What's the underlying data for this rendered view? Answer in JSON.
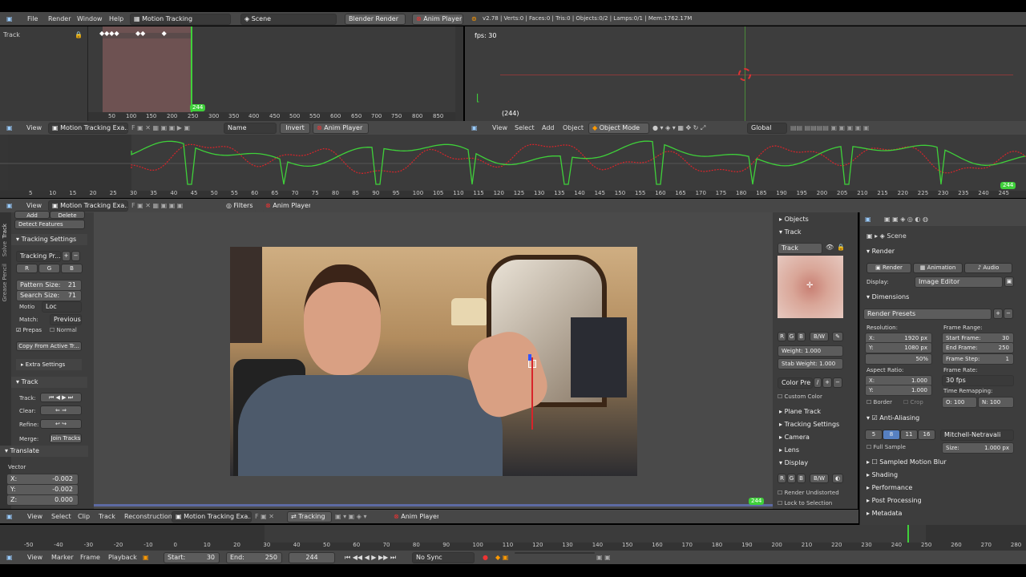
{
  "top": {
    "menus": [
      "File",
      "Render",
      "Window",
      "Help"
    ],
    "layout": "Motion Tracking",
    "scene": "Scene",
    "engine": "Blender Render",
    "anim_player": "Anim Player",
    "stats": "v2.78 | Verts:0 | Faces:0 | Tris:0 | Objects:0/2 | Lamps:0/1 | Mem:1762.17M"
  },
  "dopesheet": {
    "label": "Track",
    "frame_badge": "244",
    "ticks": [
      "50",
      "100",
      "150",
      "200",
      "250",
      "300",
      "350",
      "400",
      "450",
      "500",
      "550",
      "600",
      "650",
      "700",
      "750",
      "800",
      "850"
    ]
  },
  "view3d": {
    "fps": "fps: 30",
    "frame": "(244)",
    "menus": [
      "View",
      "Select",
      "Add",
      "Object"
    ],
    "mode": "Object Mode",
    "orientation": "Global"
  },
  "clip_header1": {
    "menu": "View",
    "clip": "Motion Tracking Exa...",
    "name_field": "Name",
    "invert": "Invert",
    "anim_player": "Anim Player"
  },
  "graph": {
    "ticks": [
      "5",
      "10",
      "15",
      "20",
      "25",
      "30",
      "35",
      "40",
      "45",
      "50",
      "55",
      "60",
      "65",
      "70",
      "75",
      "80",
      "85",
      "90",
      "95",
      "100",
      "105",
      "110",
      "115",
      "120",
      "125",
      "130",
      "135",
      "140",
      "145",
      "150",
      "155",
      "160",
      "165",
      "170",
      "175",
      "180",
      "185",
      "190",
      "195",
      "200",
      "205",
      "210",
      "215",
      "220",
      "225",
      "230",
      "235",
      "240",
      "245"
    ],
    "frame_badge": "244",
    "colors": {
      "red": "#d8242a",
      "green": "#3fd03a"
    }
  },
  "clip_header2": {
    "menu": "View",
    "clip": "Motion Tracking Exa...",
    "filters": "Filters",
    "anim_player": "Anim Player"
  },
  "left_panel": {
    "tabs": [
      "Track",
      "Solve",
      "Grease Pencil"
    ],
    "add": "Add",
    "delete": "Delete",
    "detect": "Detect Features",
    "tracking_settings": "Tracking Settings",
    "preset": "Tracking Pr...",
    "rgb": [
      "R",
      "G",
      "B"
    ],
    "pattern_size_label": "Pattern Size:",
    "pattern_size": "21",
    "search_size_label": "Search Size:",
    "search_size": "71",
    "motion_label": "Motio",
    "motion": "Loc",
    "match_label": "Match:",
    "match": "Previous",
    "prepass": "Prepas",
    "normalize": "Normal",
    "copy": "Copy From Active Tr...",
    "extra": "Extra Settings",
    "track_panel": "Track",
    "track_label": "Track:",
    "clear_label": "Clear:",
    "refine_label": "Refine:",
    "merge_label": "Merge:",
    "join": "Join Tracks",
    "translate": "Translate",
    "vector": "Vector",
    "x_label": "X:",
    "x": "-0.002",
    "y_label": "Y:",
    "y": "-0.002",
    "z_label": "Z:",
    "z": "0.000"
  },
  "clip_view": {
    "frame_badge": "244"
  },
  "track_panel": {
    "objects": "Objects",
    "track": "Track",
    "track_name": "Track",
    "rgb": [
      "R",
      "G",
      "B"
    ],
    "bw": "B/W",
    "weight_label": "Weight:",
    "weight": "1.000",
    "stab_label": "Stab Weight:",
    "stab": "1.000",
    "color_preset": "Color Pre",
    "custom_color": "Custom Color",
    "sections": [
      "Plane Track",
      "Tracking Settings",
      "Camera",
      "Lens"
    ],
    "display": "Display",
    "render_undistorted": "Render Undistorted",
    "lock_selection": "Lock to Selection"
  },
  "properties": {
    "scene": "Scene",
    "render": "Render",
    "render_btn": "Render",
    "animation_btn": "Animation",
    "audio_btn": "Audio",
    "display_label": "Display:",
    "display": "Image Editor",
    "dimensions": "Dimensions",
    "presets": "Render Presets",
    "resolution": "Resolution:",
    "res_x_label": "X:",
    "res_x": "1920 px",
    "res_y_label": "Y:",
    "res_y": "1080 px",
    "res_pct": "50%",
    "frame_range": "Frame Range:",
    "start_label": "Start Frame:",
    "start": "30",
    "end_label": "End Frame:",
    "end": "250",
    "step_label": "Frame Step:",
    "step": "1",
    "aspect": "Aspect Ratio:",
    "asp_x_label": "X:",
    "asp_x": "1.000",
    "asp_y_label": "Y:",
    "asp_y": "1.000",
    "frame_rate": "Frame Rate:",
    "fps": "30 fps",
    "time_remap": "Time Remapping:",
    "remap_o": "O: 100",
    "remap_n": "N: 100",
    "border": "Border",
    "crop": "Crop",
    "antialias": "Anti-Aliasing",
    "aa_samples": [
      "5",
      "8",
      "11",
      "16"
    ],
    "aa_filter": "Mitchell-Netravali",
    "full_sample": "Full Sample",
    "size_label": "Size:",
    "size": "1.000 px",
    "sections": [
      "Sampled Motion Blur",
      "Shading",
      "Performance",
      "Post Processing",
      "Metadata"
    ]
  },
  "clip_footer": {
    "menus": [
      "View",
      "Select",
      "Clip",
      "Track",
      "Reconstruction"
    ],
    "clip": "Motion Tracking Exa...",
    "mode": "Tracking",
    "anim_player": "Anim Player"
  },
  "timeline": {
    "ticks": [
      "-50",
      "-40",
      "-30",
      "-20",
      "-10",
      "0",
      "10",
      "20",
      "30",
      "40",
      "50",
      "60",
      "70",
      "80",
      "90",
      "100",
      "110",
      "120",
      "130",
      "140",
      "150",
      "160",
      "170",
      "180",
      "190",
      "200",
      "210",
      "220",
      "230",
      "240",
      "250",
      "260",
      "270",
      "280"
    ],
    "menus": [
      "View",
      "Marker",
      "Frame",
      "Playback"
    ],
    "start_label": "Start:",
    "start": "30",
    "end_label": "End:",
    "end": "250",
    "current": "244",
    "sync": "No Sync"
  }
}
